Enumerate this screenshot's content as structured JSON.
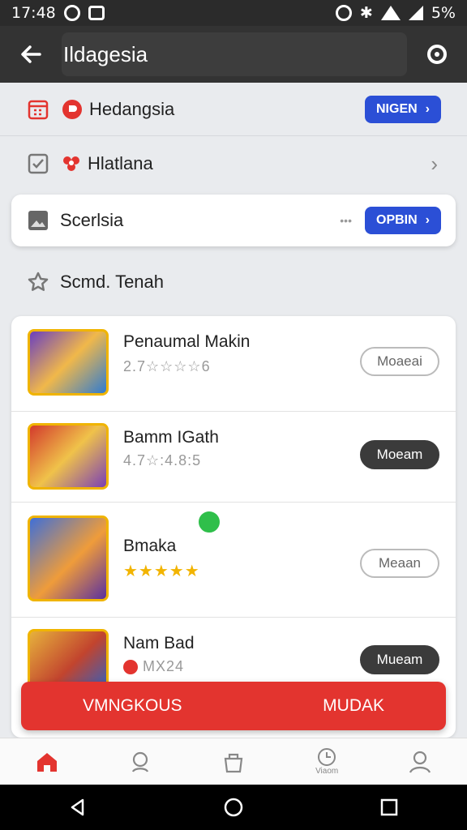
{
  "status": {
    "time": "17:48",
    "battery": "5%"
  },
  "appbar": {
    "title": "Ildagesia"
  },
  "rows": [
    {
      "label": "Hedangsia",
      "button": "NIGEN"
    },
    {
      "label": "Hlatlana"
    },
    {
      "label": "Scerlsia",
      "button": "OPBIN",
      "dots": "•••"
    },
    {
      "label": "Scmd. Tenah"
    }
  ],
  "games": [
    {
      "title": "Penaumal Makin",
      "rating": "2.7☆☆☆☆6",
      "button": "Moaeai",
      "style": "outline"
    },
    {
      "title": "Bamm IGath",
      "rating": "4.7☆:4.8:5",
      "button": "Moeam",
      "style": "dark"
    },
    {
      "title": "Bmaka",
      "rating": "★★★★★",
      "button": "Meaan",
      "style": "outline"
    },
    {
      "title": "Nam Bad",
      "rating": "MX24",
      "button": "Mueam",
      "style": "dark"
    }
  ],
  "fab": {
    "left": "VMNGKOUS",
    "right": "MUDAK"
  },
  "nav": {
    "tab4": "Viaom"
  },
  "colors": {
    "accent": "#e3342f",
    "primary": "#2b4fd6",
    "appbar": "#333333"
  }
}
